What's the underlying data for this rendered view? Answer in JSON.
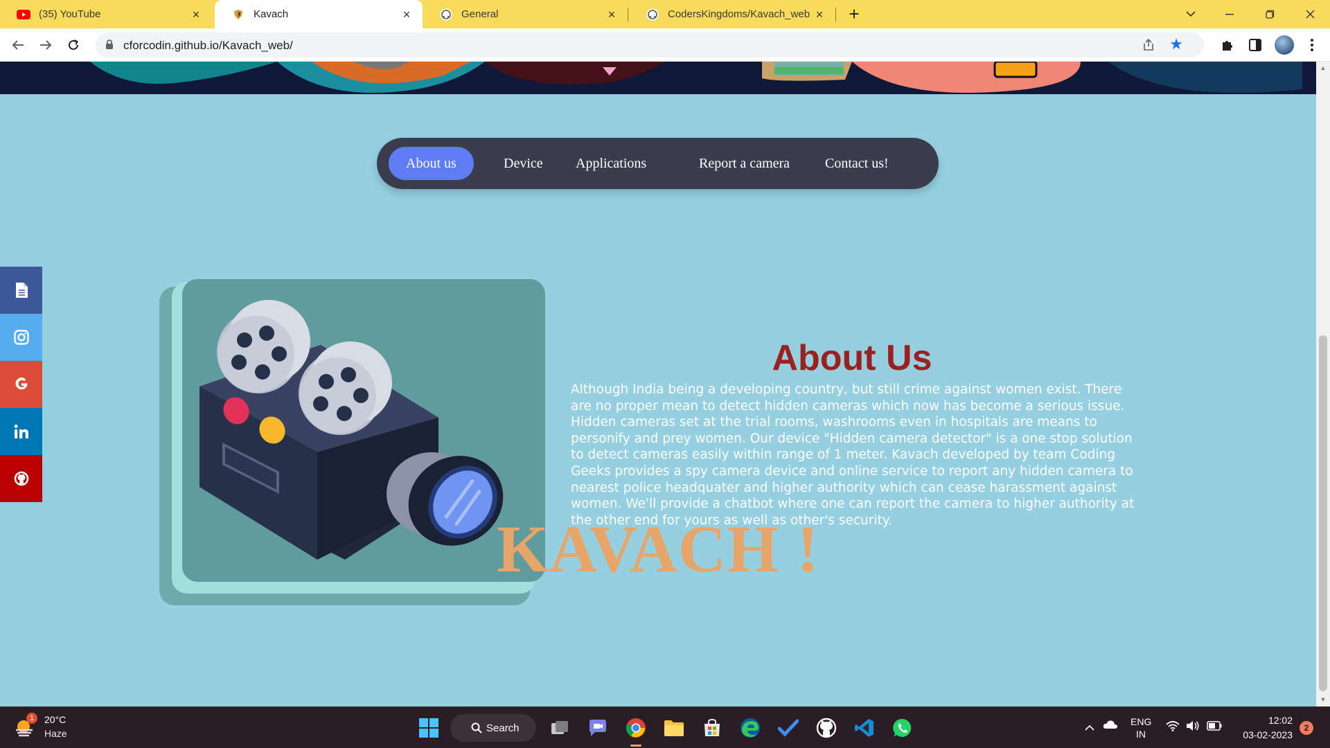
{
  "browser": {
    "tabs": [
      {
        "label": "(35) YouTube",
        "icon": "youtube-icon",
        "active": false
      },
      {
        "label": "Kavach",
        "icon": "kavach-favicon-icon",
        "active": true
      },
      {
        "label": "General",
        "icon": "github-icon",
        "active": false
      },
      {
        "label": "CodersKingdoms/Kavach_web",
        "icon": "github-icon",
        "active": false
      }
    ],
    "url": "cforcodin.github.io/Kavach_web/"
  },
  "page": {
    "nav": {
      "items": [
        "About us",
        "Device",
        "Applications",
        "Report a camera",
        "Contact us!"
      ],
      "active_index": 0
    },
    "social": [
      {
        "icon": "document-icon",
        "color": "#3b5998"
      },
      {
        "icon": "instagram-icon",
        "color": "#55acee"
      },
      {
        "icon": "google-icon",
        "color": "#dd4b39"
      },
      {
        "icon": "linkedin-icon",
        "color": "#0077b5"
      },
      {
        "icon": "github-icon",
        "color": "#bb0000"
      }
    ],
    "about": {
      "title": "About Us",
      "body": "Although India being a developing country, but still crime against women exist. There are no proper mean to detect hidden cameras which now has become a serious issue. Hidden cameras set at the trial rooms, washrooms even in hospitals are means to personify and prey women. Our device \"Hidden camera detector\" is a one stop solution to detect cameras easily within range of 1 meter. Kavach developed by team Coding Geeks provides a spy camera device and online service to report any hidden camera to nearest police headquater and higher authority which can cease harassment against women. We'll provide a chatbot where one can report the camera to higher authority at the other end for yours as well as other's security."
    },
    "brand": "KAVACH !",
    "colors": {
      "nav_active": "#5e7df2",
      "title": "#9b2121",
      "brand": "#e8a56a",
      "background": "#96d0e0"
    }
  },
  "taskbar": {
    "weather": {
      "temp": "20°C",
      "condition": "Haze",
      "badge": "1"
    },
    "search_label": "Search",
    "language": {
      "line1": "ENG",
      "line2": "IN"
    },
    "time": "12:02",
    "date": "03-02-2023",
    "notifications": "2"
  }
}
